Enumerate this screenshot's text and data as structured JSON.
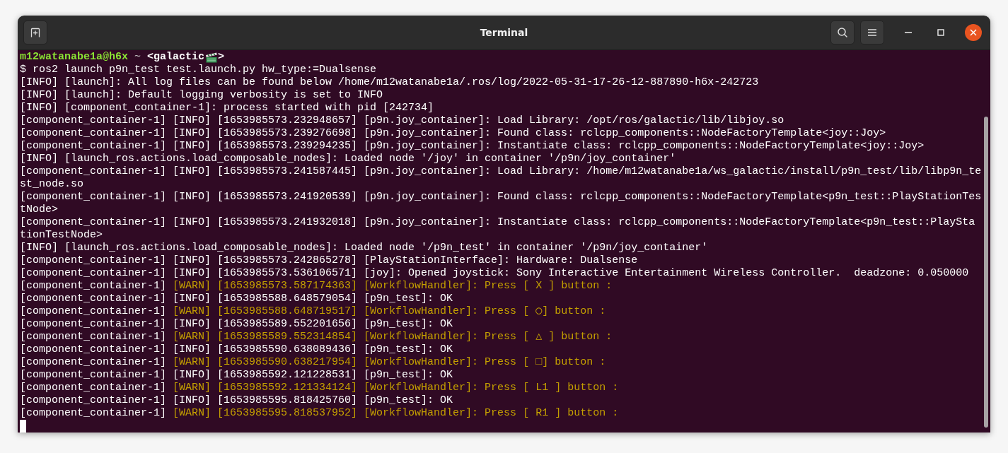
{
  "window": {
    "title": "Terminal"
  },
  "prompt": {
    "user": "m12watanabe1a@h6x",
    "path": "~",
    "env_open": "<galactic",
    "env_close": ">"
  },
  "lines": [
    {
      "text": "$ ros2 launch p9n_test test.launch.py hw_type:=Dualsense"
    },
    {
      "text": "[INFO] [launch]: All log files can be found below /home/m12watanabe1a/.ros/log/2022-05-31-17-26-12-887890-h6x-242723"
    },
    {
      "text": "[INFO] [launch]: Default logging verbosity is set to INFO"
    },
    {
      "text": "[INFO] [component_container-1]: process started with pid [242734]"
    },
    {
      "text": "[component_container-1] [INFO] [1653985573.232948657] [p9n.joy_container]: Load Library: /opt/ros/galactic/lib/libjoy.so"
    },
    {
      "text": "[component_container-1] [INFO] [1653985573.239276698] [p9n.joy_container]: Found class: rclcpp_components::NodeFactoryTemplate<joy::Joy>"
    },
    {
      "text": "[component_container-1] [INFO] [1653985573.239294235] [p9n.joy_container]: Instantiate class: rclcpp_components::NodeFactoryTemplate<joy::Joy>"
    },
    {
      "text": "[INFO] [launch_ros.actions.load_composable_nodes]: Loaded node '/joy' in container '/p9n/joy_container'"
    },
    {
      "text": "[component_container-1] [INFO] [1653985573.241587445] [p9n.joy_container]: Load Library: /home/m12watanabe1a/ws_galactic/install/p9n_test/lib/libp9n_te"
    },
    {
      "text": "st_node.so"
    },
    {
      "text": "[component_container-1] [INFO] [1653985573.241920539] [p9n.joy_container]: Found class: rclcpp_components::NodeFactoryTemplate<p9n_test::PlayStationTes"
    },
    {
      "text": "tNode>"
    },
    {
      "text": "[component_container-1] [INFO] [1653985573.241932018] [p9n.joy_container]: Instantiate class: rclcpp_components::NodeFactoryTemplate<p9n_test::PlaySta"
    },
    {
      "text": "tionTestNode>"
    },
    {
      "text": "[INFO] [launch_ros.actions.load_composable_nodes]: Loaded node '/p9n_test' in container '/p9n/joy_container'"
    },
    {
      "text": "[component_container-1] [INFO] [1653985573.242865278] [PlayStationInterface]: Hardware: Dualsense"
    },
    {
      "text": "[component_container-1] [INFO] [1653985573.536106571] [joy]: Opened joystick: Sony Interactive Entertainment Wireless Controller.  deadzone: 0.050000"
    },
    {
      "text": "[component_container-1] ",
      "warn_text": "[WARN] [1653985573.587174363] [WorkflowHandler]: Press [ X ] button :"
    },
    {
      "text": "[component_container-1] [INFO] [1653985588.648579054] [p9n_test]: OK"
    },
    {
      "text": "[component_container-1] ",
      "warn_text": "[WARN] [1653985588.648719517] [WorkflowHandler]: Press [ ◯] button :"
    },
    {
      "text": "[component_container-1] [INFO] [1653985589.552201656] [p9n_test]: OK"
    },
    {
      "text": "[component_container-1] ",
      "warn_text": "[WARN] [1653985589.552314854] [WorkflowHandler]: Press [ △ ] button :"
    },
    {
      "text": "[component_container-1] [INFO] [1653985590.638089436] [p9n_test]: OK"
    },
    {
      "text": "[component_container-1] ",
      "warn_text": "[WARN] [1653985590.638217954] [WorkflowHandler]: Press [ □] button :"
    },
    {
      "text": "[component_container-1] [INFO] [1653985592.121228531] [p9n_test]: OK"
    },
    {
      "text": "[component_container-1] ",
      "warn_text": "[WARN] [1653985592.121334124] [WorkflowHandler]: Press [ L1 ] button :"
    },
    {
      "text": "[component_container-1] [INFO] [1653985595.818425760] [p9n_test]: OK"
    },
    {
      "text": "[component_container-1] ",
      "warn_text": "[WARN] [1653985595.818537952] [WorkflowHandler]: Press [ R1 ] button :"
    }
  ]
}
